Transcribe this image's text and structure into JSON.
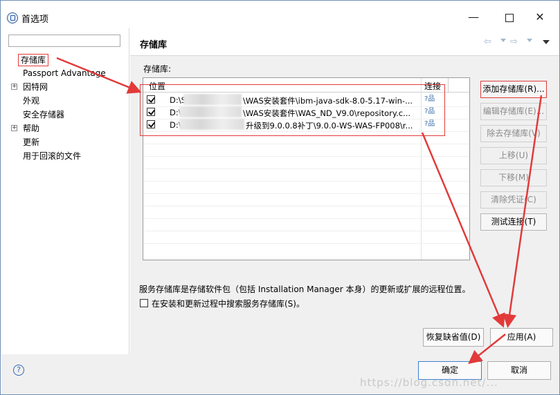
{
  "window": {
    "title": "首选项",
    "min_glyph": "—",
    "close_glyph": "✕"
  },
  "filter": {
    "value": "",
    "placeholder": ""
  },
  "tree": {
    "items": [
      {
        "label": "存储库",
        "selected": true,
        "expandable": false
      },
      {
        "label": "Passport Advantage",
        "expandable": false
      },
      {
        "label": "因特网",
        "expandable": true
      },
      {
        "label": "外观",
        "expandable": false
      },
      {
        "label": "安全存储器",
        "expandable": false
      },
      {
        "label": "帮助",
        "expandable": true
      },
      {
        "label": "更新",
        "expandable": false
      },
      {
        "label": "用于回滚的文件",
        "expandable": false
      }
    ],
    "expander_glyph": "+"
  },
  "page": {
    "title": "存储库",
    "section_label": "存储库:",
    "nav": {
      "back": "⇦",
      "forward": "⇨"
    }
  },
  "table": {
    "headers": {
      "location": "位置",
      "connection": "连接"
    },
    "rows": [
      {
        "checked": true,
        "prefix": "D:\\S",
        "rest": "\\WAS安装套件\\ibm-java-sdk-8.0-5.17-win-...",
        "conn": "?品"
      },
      {
        "checked": true,
        "prefix": "D:\\",
        "rest": "\\WAS安装套件\\WAS_ND_V9.0\\repository.c...",
        "conn": "?品"
      },
      {
        "checked": true,
        "prefix": "D:\\",
        "rest": "升级到9.0.0.8补丁\\9.0.0-WS-WAS-FP008\\r...",
        "conn": "?品"
      }
    ]
  },
  "buttons": {
    "add": "添加存储库(R)...",
    "edit": "编辑存储库(E)...",
    "remove": "除去存储库(V)",
    "move_up": "上移(U)",
    "move_down": "下移(M)",
    "clear_credentials": "清除凭证(C)",
    "test_connection": "测试连接(T)",
    "restore_defaults": "恢复缺省值(D)",
    "apply": "应用(A)",
    "ok": "确定",
    "cancel": "取消"
  },
  "description": "服务存储库是存储软件包（包括 Installation Manager 本身）的更新或扩展的远程位置。",
  "search_option": {
    "label": "在安装和更新过程中搜索服务存储库(S)。",
    "checked": false
  },
  "help_glyph": "?",
  "watermark": "https://blog.csdn.net/..."
}
